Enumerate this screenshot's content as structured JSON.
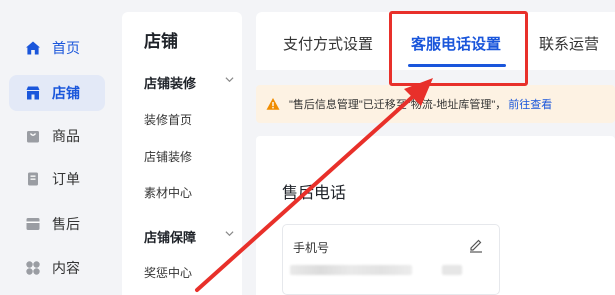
{
  "nav": {
    "items": [
      {
        "label": "首页",
        "icon": "home-icon"
      },
      {
        "label": "店铺",
        "icon": "store-icon",
        "active": true
      },
      {
        "label": "商品",
        "icon": "product-bag-icon"
      },
      {
        "label": "订单",
        "icon": "order-icon"
      },
      {
        "label": "售后",
        "icon": "after-sales-icon"
      },
      {
        "label": "内容",
        "icon": "content-grid-icon"
      }
    ]
  },
  "subnav": {
    "title": "店铺",
    "groups": [
      {
        "label": "店铺装修",
        "items": [
          "装修首页",
          "店铺装修",
          "素材中心"
        ]
      },
      {
        "label": "店铺保障",
        "items": [
          "奖惩中心"
        ]
      }
    ]
  },
  "tabs": [
    "支付方式设置",
    "客服电话设置",
    "联系运营"
  ],
  "active_tab": "客服电话设置",
  "alert": {
    "text": "\"售后信息管理\"已迁移至\"物流-地址库管理\"，",
    "link": "前往查看"
  },
  "section": {
    "title": "售后电话",
    "card_label": "手机号"
  },
  "colors": {
    "accent": "#1a56db",
    "annotation": "#e8302a",
    "warning": "#f08c00"
  }
}
